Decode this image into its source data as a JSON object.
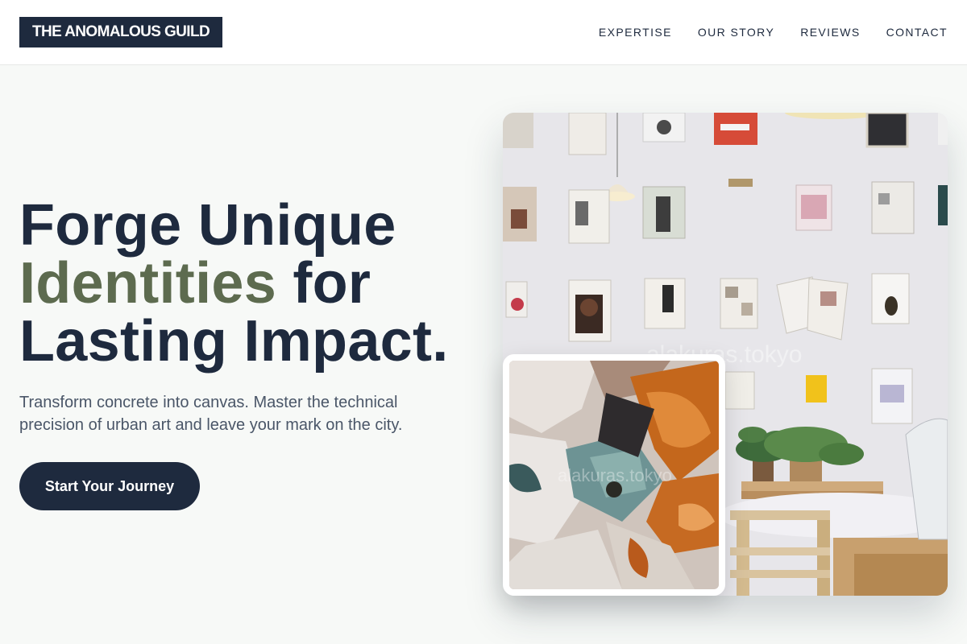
{
  "brand": {
    "name": "THE ANOMALOUS GUILD"
  },
  "nav": {
    "items": [
      {
        "label": "EXPERTISE"
      },
      {
        "label": "OUR STORY"
      },
      {
        "label": "REVIEWS"
      },
      {
        "label": "CONTACT"
      }
    ]
  },
  "hero": {
    "headline_part1": "Forge Unique",
    "headline_accent": "Identities",
    "headline_part2": " for",
    "headline_part3": "Lasting Impact.",
    "subtext": "Transform concrete into canvas. Master the technical precision of urban art and leave your mark on the city.",
    "cta_label": "Start Your Journey"
  },
  "images": {
    "main_alt": "Studio wall with clipboards of magazines, pendant lamp, plants and table",
    "inset_alt": "Close-up of thick textured paint strokes in orange, teal and white"
  },
  "colors": {
    "primary": "#1e2a3e",
    "accent": "#5d6b4f",
    "background": "#f7f9f7",
    "text_muted": "#4a5668"
  }
}
